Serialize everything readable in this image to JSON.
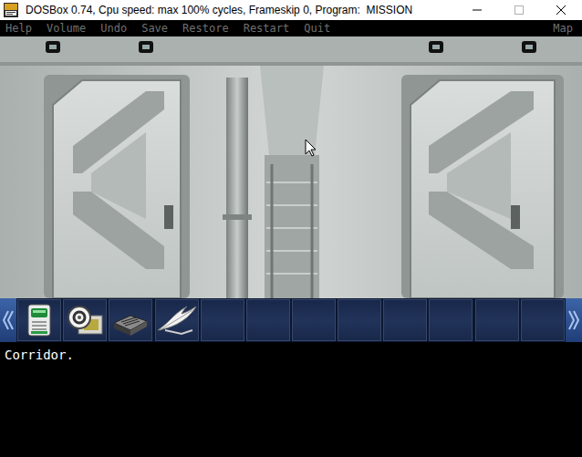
{
  "window": {
    "title": "DOSBox 0.74, Cpu speed: max 100% cycles, Frameskip 0, Program:  MISSION"
  },
  "menu": [
    "Help",
    "Volume",
    "Undo",
    "Save",
    "Restore",
    "Restart",
    "Quit"
  ],
  "menu_right": "Map",
  "inventory": {
    "slots": [
      {
        "kind": "card"
      },
      {
        "kind": "disk"
      },
      {
        "kind": "device"
      },
      {
        "kind": "feather"
      },
      {
        "kind": "empty"
      },
      {
        "kind": "empty"
      },
      {
        "kind": "empty"
      },
      {
        "kind": "empty"
      },
      {
        "kind": "empty"
      },
      {
        "kind": "empty"
      },
      {
        "kind": "empty"
      },
      {
        "kind": "empty"
      }
    ]
  },
  "message": "Corridor."
}
